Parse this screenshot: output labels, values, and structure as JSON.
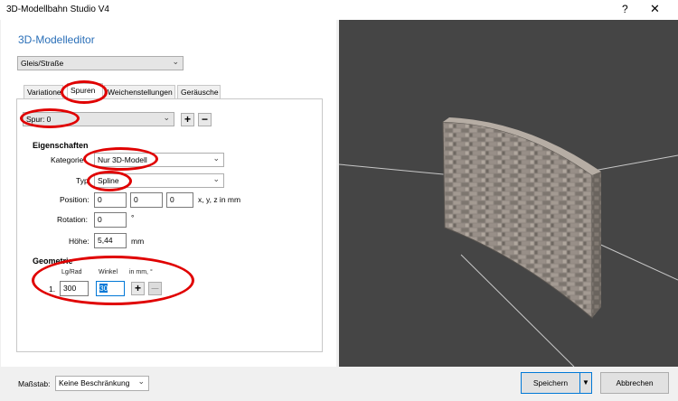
{
  "window": {
    "title": "3D-Modellbahn Studio V4",
    "help_glyph": "?",
    "close_glyph": "✕"
  },
  "editor": {
    "heading": "3D-Modelleditor",
    "type_select": "Gleis/Straße",
    "tabs": [
      "Variationen",
      "Spuren",
      "Weichenstellungen",
      "Geräusche"
    ],
    "active_tab": "Spuren",
    "spur_select": "Spur: 0",
    "add_glyph": "+",
    "remove_glyph": "−",
    "eigenschaften": {
      "section_label": "Eigenschaften",
      "kategorie_label": "Kategorie",
      "kategorie_value": "Nur 3D-Modell",
      "typ_label": "Typ",
      "typ_value": "Spline",
      "position_label": "Position:",
      "position_values": [
        "0",
        "0",
        "0"
      ],
      "position_unit": "x, y, z in mm",
      "rotation_label": "Rotation:",
      "rotation_value": "0",
      "rotation_unit": "°",
      "hoehe_label": "Höhe:",
      "hoehe_value": "5,44",
      "hoehe_unit": "mm"
    },
    "geometrie": {
      "section_label": "Geometrie",
      "col_lg_rad": "Lg/Rad",
      "col_winkel": "Winkel",
      "col_units": "in mm, °",
      "row_index": "1.",
      "lg_rad_value": "300",
      "winkel_value": "30",
      "add_glyph": "+",
      "remove_glyph": "—"
    }
  },
  "footer": {
    "massstab_label": "Maßstab:",
    "massstab_value": "Keine Beschränkung",
    "save_label": "Speichern",
    "cancel_label": "Abbrechen"
  },
  "colors": {
    "accent": "#2a6fb8",
    "focus": "#0078d7",
    "annotation": "#e00000",
    "viewport": "#454545"
  }
}
